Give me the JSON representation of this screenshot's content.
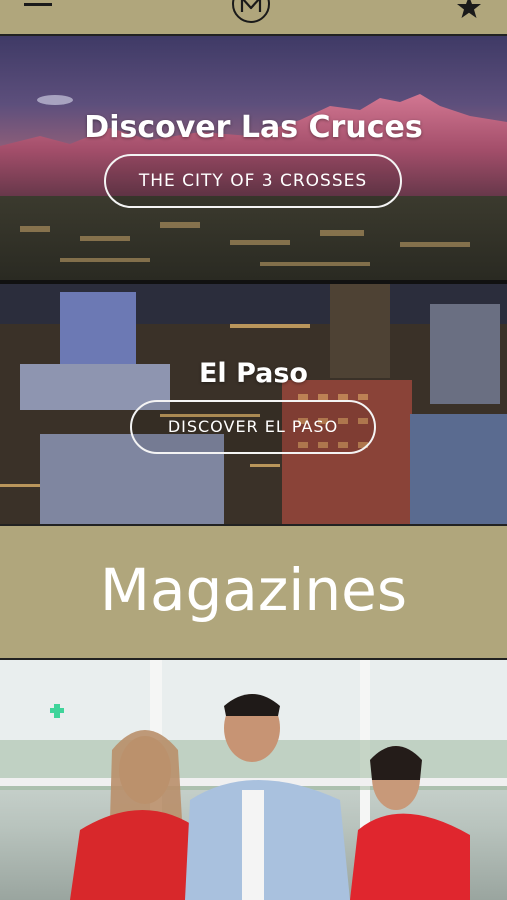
{
  "header": {
    "menu_icon": "hamburger-menu-icon",
    "logo_icon": "logo-icon",
    "favorite_icon": "star-icon"
  },
  "sections": [
    {
      "title": "Discover Las Cruces",
      "button_label": "THE CITY OF 3 CROSSES"
    },
    {
      "title": "El Paso",
      "button_label": "DISCOVER EL PASO"
    }
  ],
  "magazines": {
    "title": "Magazines"
  },
  "colors": {
    "header_bg": "#b0a67c",
    "banner_bg": "#b0a67c",
    "text_light": "#ffffff",
    "icon_dark": "#1a1a1a"
  }
}
